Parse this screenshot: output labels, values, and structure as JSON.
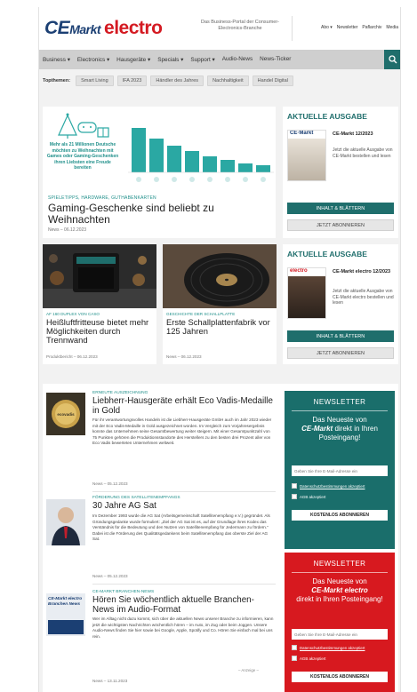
{
  "header": {
    "logo_ce": "CE",
    "logo_markt": "Markt",
    "logo_electro": "electro",
    "tagline": "Das Business-Portal der Consumer-Electronics-Branche",
    "links": [
      "Abo ▾",
      "Newsletter",
      "Paflarchiv",
      "Media"
    ]
  },
  "nav": {
    "items": [
      "Business ▾",
      "Electronics ▾",
      "Hausgeräte ▾",
      "Specials ▾",
      "Support ▾",
      "Audio-News",
      "News-Ticker"
    ]
  },
  "topics": {
    "label": "Topthemen:",
    "items": [
      "Smart Living",
      "IFA 2023",
      "Händler des Jahres",
      "Nachhaltigkeit",
      "Handel Digital"
    ]
  },
  "hero": {
    "graphic_text": "Mehr als 21 Millionen Deutsche möchten zu Weihnachten mit Games oder Gaming-Geschenken ihren Liebsten eine Freude bereiten",
    "category": "SPIELETIPPS, HARDWARE, GUTHABENKARTEN",
    "title": "Gaming-Geschenke sind beliebt zu Weihnachten",
    "meta": "News – 06.12.2023"
  },
  "mag1": {
    "heading": "AKTUELLE AUSGABE",
    "cover_label": "CE·Markt",
    "title": "CE-Markt 12/2023",
    "text": "Jetzt die aktuelle Ausgabe von CE-Markt bestellen und lesen",
    "primary": "INHALT & BLÄTTERN",
    "secondary": "JETZT ABONNIEREN"
  },
  "mag2": {
    "heading": "AKTUELLE AUSGABE",
    "cover_label": "electro",
    "title": "CE-Markt electro 12/2023",
    "text": "Jetzt die aktuelle Ausgabe von CE-Markt electro bestellen und lesen",
    "primary": "INHALT & BLÄTTERN",
    "secondary": "JETZT ABONNIEREN"
  },
  "card1": {
    "category": "AF 160 DUPLEX VON CASO",
    "title": "Heißluftfritteuse bietet mehr Möglichkeiten durch Trennwand",
    "meta": "Produktbericht – 06.12.2023"
  },
  "card2": {
    "category": "GESCHICHTE DER SCHALLPLATTE",
    "title": "Erste Schallplattenfabrik vor 125 Jahren",
    "meta": "News – 06.12.2023"
  },
  "news": [
    {
      "category": "ERNEUTE AUSZEICHNUNG",
      "title": "Liebherr-Hausgeräte erhält Eco Vadis-Medaille in Gold",
      "body": "Für ihr verantwortungsvolles Handeln ist die Liebherr-Hausgeräte GmbH auch im Jahr 2023 wieder mit der Eco Vadis-Medaille in Gold ausgezeichnet worden. Im Vergleich zum Vorjahresergebnis konnte das Unternehmen seine Gesamtbewertung weiter steigern. Mit einer Gesamtpunktzahl von 75 Punkten gehören die Produktionsstandorte des Herstellers zu den besten drei Prozent aller von Eco Vadis bewerteten Unternehmen weltweit.",
      "meta": "News – 05.12.2023",
      "thumb_text": "ecovadis"
    },
    {
      "category": "FÖRDERUNG DES SATELLITENEMPFANGS",
      "title": "30 Jahre AG Sat",
      "body": "Im Dezember 1993 wurde die AG Sat (Arbeitsgemeinschaft Satellitenempfang e.V.) gegründet. Als Gründungsgedanke wurde formuliert: „Ziel der AG Sat ist es, auf der Grundlage ihres Kodex das Verständnis für die Bedeutung und den Nutzen von Satellitenempfang für Jedermann zu fördern.“ Dabei ist die Förderung des Qualitätsgedankens beim Satellitenempfang das oberste Ziel der AG Sat.",
      "meta": "News – 05.12.2023",
      "thumb_text": ""
    },
    {
      "category": "CE-MARKT BRANCHEN-NEWS",
      "title": "Hören Sie wöchentlich aktuelle Branchen-News im Audio-Format",
      "body": "Wer im Alltag nicht dazu kommt, sich über die aktuellen News unserer Branche zu informieren, kann jetzt die wichtigsten Nachrichten wöchentlich hören – im Auto, im Zug oder beim Joggen. Unsere Audio-News finden Sie hier sowie bei Google, Apple, Spotify und Co. Hören Sie einfach mal bei uns rein.",
      "meta": "News – 13.11.2023",
      "thumb_text": "CE-Markt electro Branchen News",
      "ad": "– Anzeige –"
    }
  ],
  "newsletter1": {
    "heading": "NEWSLETTER",
    "text_pre": "Das Neueste von",
    "brand": "CE-Markt",
    "text_post": "direkt in Ihren Posteingang!",
    "placeholder": "Geben Sie Ihre E-Mail-Adresse ein",
    "check1": "Datenschutzbestimmungen akzeptiert",
    "check2": "AGB akzeptiert",
    "button": "KOSTENLOS ABONNIEREN"
  },
  "newsletter2": {
    "heading": "NEWSLETTER",
    "text_pre": "Das Neueste von",
    "brand": "CE-Markt electro",
    "text_post": "direkt in Ihren Posteingang!",
    "placeholder": "Geben Sie Ihre E-Mail-Adresse ein",
    "check1": "Datenschutzbestimmungen akzeptiert",
    "check2": "AGB akzeptiert",
    "button": "KOSTENLOS ABONNIEREN"
  },
  "colors": {
    "teal": "#1f6e6c",
    "newsletter_teal": "#1a6e6b",
    "newsletter_red": "#d7191f",
    "brand_blue": "#1b3f73",
    "brand_red": "#d41a22"
  }
}
